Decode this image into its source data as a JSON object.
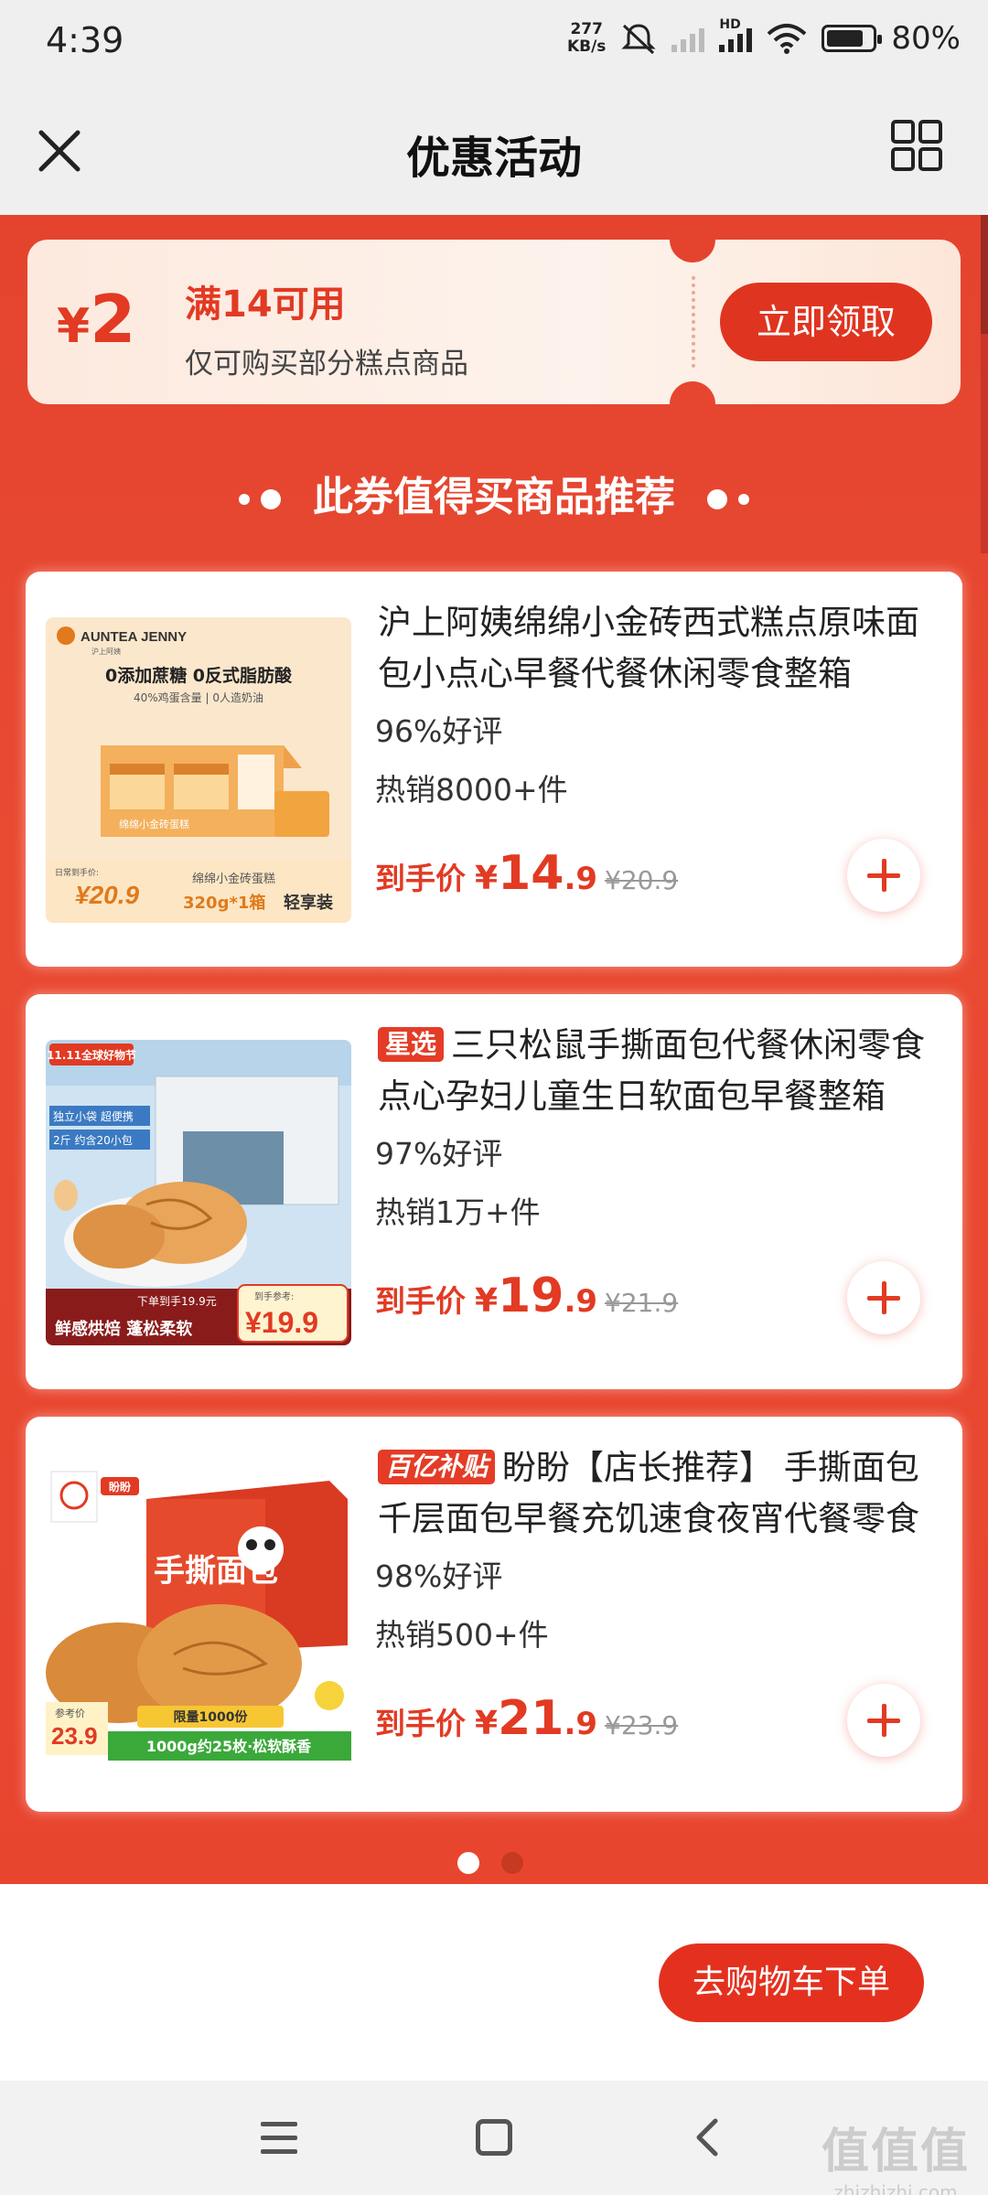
{
  "status_bar": {
    "time": "4:39",
    "net_speed_value": "277",
    "net_speed_unit": "KB/s",
    "hd_label": "HD",
    "battery": "80%"
  },
  "header": {
    "title": "优惠活动",
    "close_icon": "close-icon",
    "grid_icon": "grid-icon"
  },
  "coupon": {
    "currency": "¥",
    "amount": "2",
    "condition": "满14可用",
    "description": "仅可购买部分糕点商品",
    "claim_label": "立即领取"
  },
  "section": {
    "title": "此券值得买商品推荐"
  },
  "products": [
    {
      "tag": "",
      "title": "沪上阿姨绵绵小金砖西式糕点原味面包小点心早餐代餐休闲零食整箱",
      "rating": "96%好评",
      "sold": "热销8000+件",
      "price_label": "到手价",
      "price_symbol": "¥",
      "price_int": "14",
      "price_dec": ".9",
      "orig_price": "¥20.9",
      "thumb": {
        "brand": "AUNTEA JENNY",
        "brand_cn": "沪上阿姨",
        "headline": "0添加蔗糖 0反式脂肪酸",
        "sub": "40%鸡蛋含量 | 0人造奶油",
        "box_label": "绵绵小金砖蛋糕",
        "price_note": "日常到手价:",
        "price": "¥20.9",
        "spec1": "绵绵小金砖蛋糕",
        "spec2": "320g*1箱",
        "spec3": "轻享装"
      }
    },
    {
      "tag": "星选",
      "title": "三只松鼠手撕面包代餐休闲零食点心孕妇儿童生日软面包早餐整箱",
      "rating": "97%好评",
      "sold": "热销1万+件",
      "price_label": "到手价",
      "price_symbol": "¥",
      "price_int": "19",
      "price_dec": ".9",
      "orig_price": "¥21.9",
      "thumb": {
        "badge": "11.11全球好物节",
        "label1": "独立小袋 超便携",
        "label2": "2斤 约含20小包",
        "note": "下单到手19.9元",
        "slogan": "鲜感烘焙 蓬松柔软",
        "price_note": "到手参考:",
        "price": "¥19.9"
      }
    },
    {
      "tag": "百亿补贴",
      "title": "盼盼【店长推荐】 手撕面包千层面包早餐充饥速食夜宵代餐零食",
      "rating": "98%好评",
      "sold": "热销500+件",
      "price_label": "到手价",
      "price_symbol": "¥",
      "price_int": "21",
      "price_dec": ".9",
      "orig_price": "¥23.9",
      "thumb": {
        "brand": "盼盼",
        "box_title": "手撕面包",
        "ref_label": "参考价",
        "ref_price": "23.9",
        "limit": "限量1000份",
        "spec": "1000g约25枚·松软酥香"
      }
    }
  ],
  "checkout_label": "去购物车下单",
  "watermark": {
    "line1": "值值值",
    "line2": "zhizhizhi.com"
  },
  "colors": {
    "primary_red": "#e4442e",
    "button_red": "#df3520",
    "price_red": "#e23a23"
  }
}
